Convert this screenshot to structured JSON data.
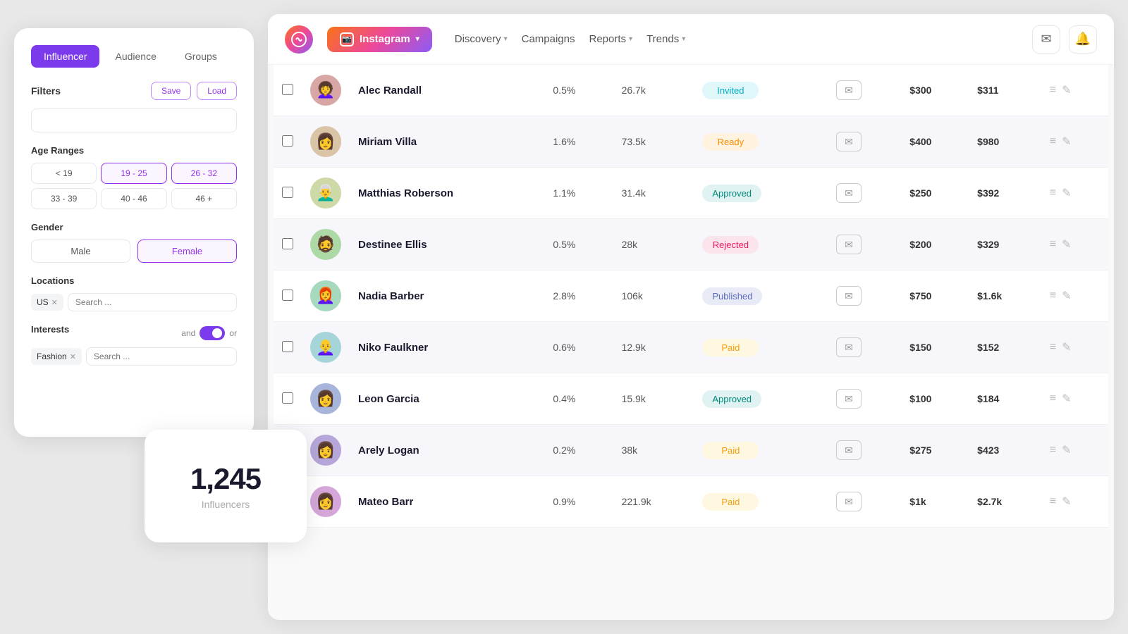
{
  "app": {
    "logo_letter": "a",
    "platform": "Instagram",
    "nav_links": [
      {
        "label": "Discovery",
        "has_chevron": true
      },
      {
        "label": "Campaigns",
        "has_chevron": false
      },
      {
        "label": "Reports",
        "has_chevron": true
      },
      {
        "label": "Trends",
        "has_chevron": true
      }
    ]
  },
  "filter_panel": {
    "tabs": [
      {
        "label": "Influencer",
        "active": true
      },
      {
        "label": "Audience",
        "active": false
      },
      {
        "label": "Groups",
        "active": false
      }
    ],
    "filters_label": "Filters",
    "save_label": "Save",
    "load_label": "Load",
    "age_ranges_label": "Age Ranges",
    "age_options": [
      {
        "label": "< 19",
        "active": false
      },
      {
        "label": "19 - 25",
        "active": true
      },
      {
        "label": "26 - 32",
        "active": true
      },
      {
        "label": "33 - 39",
        "active": false
      },
      {
        "label": "40 - 46",
        "active": false
      },
      {
        "label": "46 +",
        "active": false
      }
    ],
    "gender_label": "Gender",
    "gender_options": [
      {
        "label": "Male",
        "active": false
      },
      {
        "label": "Female",
        "active": true
      }
    ],
    "locations_label": "Locations",
    "location_tag": "US",
    "location_search_placeholder": "Search ...",
    "interests_label": "Interests",
    "interests_and": "and",
    "interests_or": "or",
    "interest_tag": "Fashion",
    "interest_search_placeholder": "Search ..."
  },
  "count_card": {
    "number": "1,245",
    "label": "Influencers"
  },
  "table": {
    "rows": [
      {
        "name": "Alec Randall",
        "er": "0.5%",
        "followers": "26.7k",
        "status": "Invited",
        "status_class": "badge-invited",
        "price1": "$300",
        "price2": "$311",
        "avatar": "👩"
      },
      {
        "name": "Miriam Villa",
        "er": "1.6%",
        "followers": "73.5k",
        "status": "Ready",
        "status_class": "badge-ready",
        "price1": "$400",
        "price2": "$980",
        "avatar": "👩"
      },
      {
        "name": "Matthias Roberson",
        "er": "1.1%",
        "followers": "31.4k",
        "status": "Approved",
        "status_class": "badge-approved",
        "price1": "$250",
        "price2": "$392",
        "avatar": "👩"
      },
      {
        "name": "Destinee Ellis",
        "er": "0.5%",
        "followers": "28k",
        "status": "Rejected",
        "status_class": "badge-rejected",
        "price1": "$200",
        "price2": "$329",
        "avatar": "🧔"
      },
      {
        "name": "Nadia Barber",
        "er": "2.8%",
        "followers": "106k",
        "status": "Published",
        "status_class": "badge-published",
        "price1": "$750",
        "price2": "$1.6k",
        "avatar": "👩"
      },
      {
        "name": "Niko Faulkner",
        "er": "0.6%",
        "followers": "12.9k",
        "status": "Paid",
        "status_class": "badge-paid",
        "price1": "$150",
        "price2": "$152",
        "avatar": "👩"
      },
      {
        "name": "Leon Garcia",
        "er": "0.4%",
        "followers": "15.9k",
        "status": "Approved",
        "status_class": "badge-approved",
        "price1": "$100",
        "price2": "$184",
        "avatar": "👩"
      },
      {
        "name": "Arely Logan",
        "er": "0.2%",
        "followers": "38k",
        "status": "Paid",
        "status_class": "badge-paid",
        "price1": "$275",
        "price2": "$423",
        "avatar": "👩"
      },
      {
        "name": "Mateo Barr",
        "er": "0.9%",
        "followers": "221.9k",
        "status": "Paid",
        "status_class": "badge-paid",
        "price1": "$1k",
        "price2": "$2.7k",
        "avatar": "👩"
      }
    ]
  }
}
